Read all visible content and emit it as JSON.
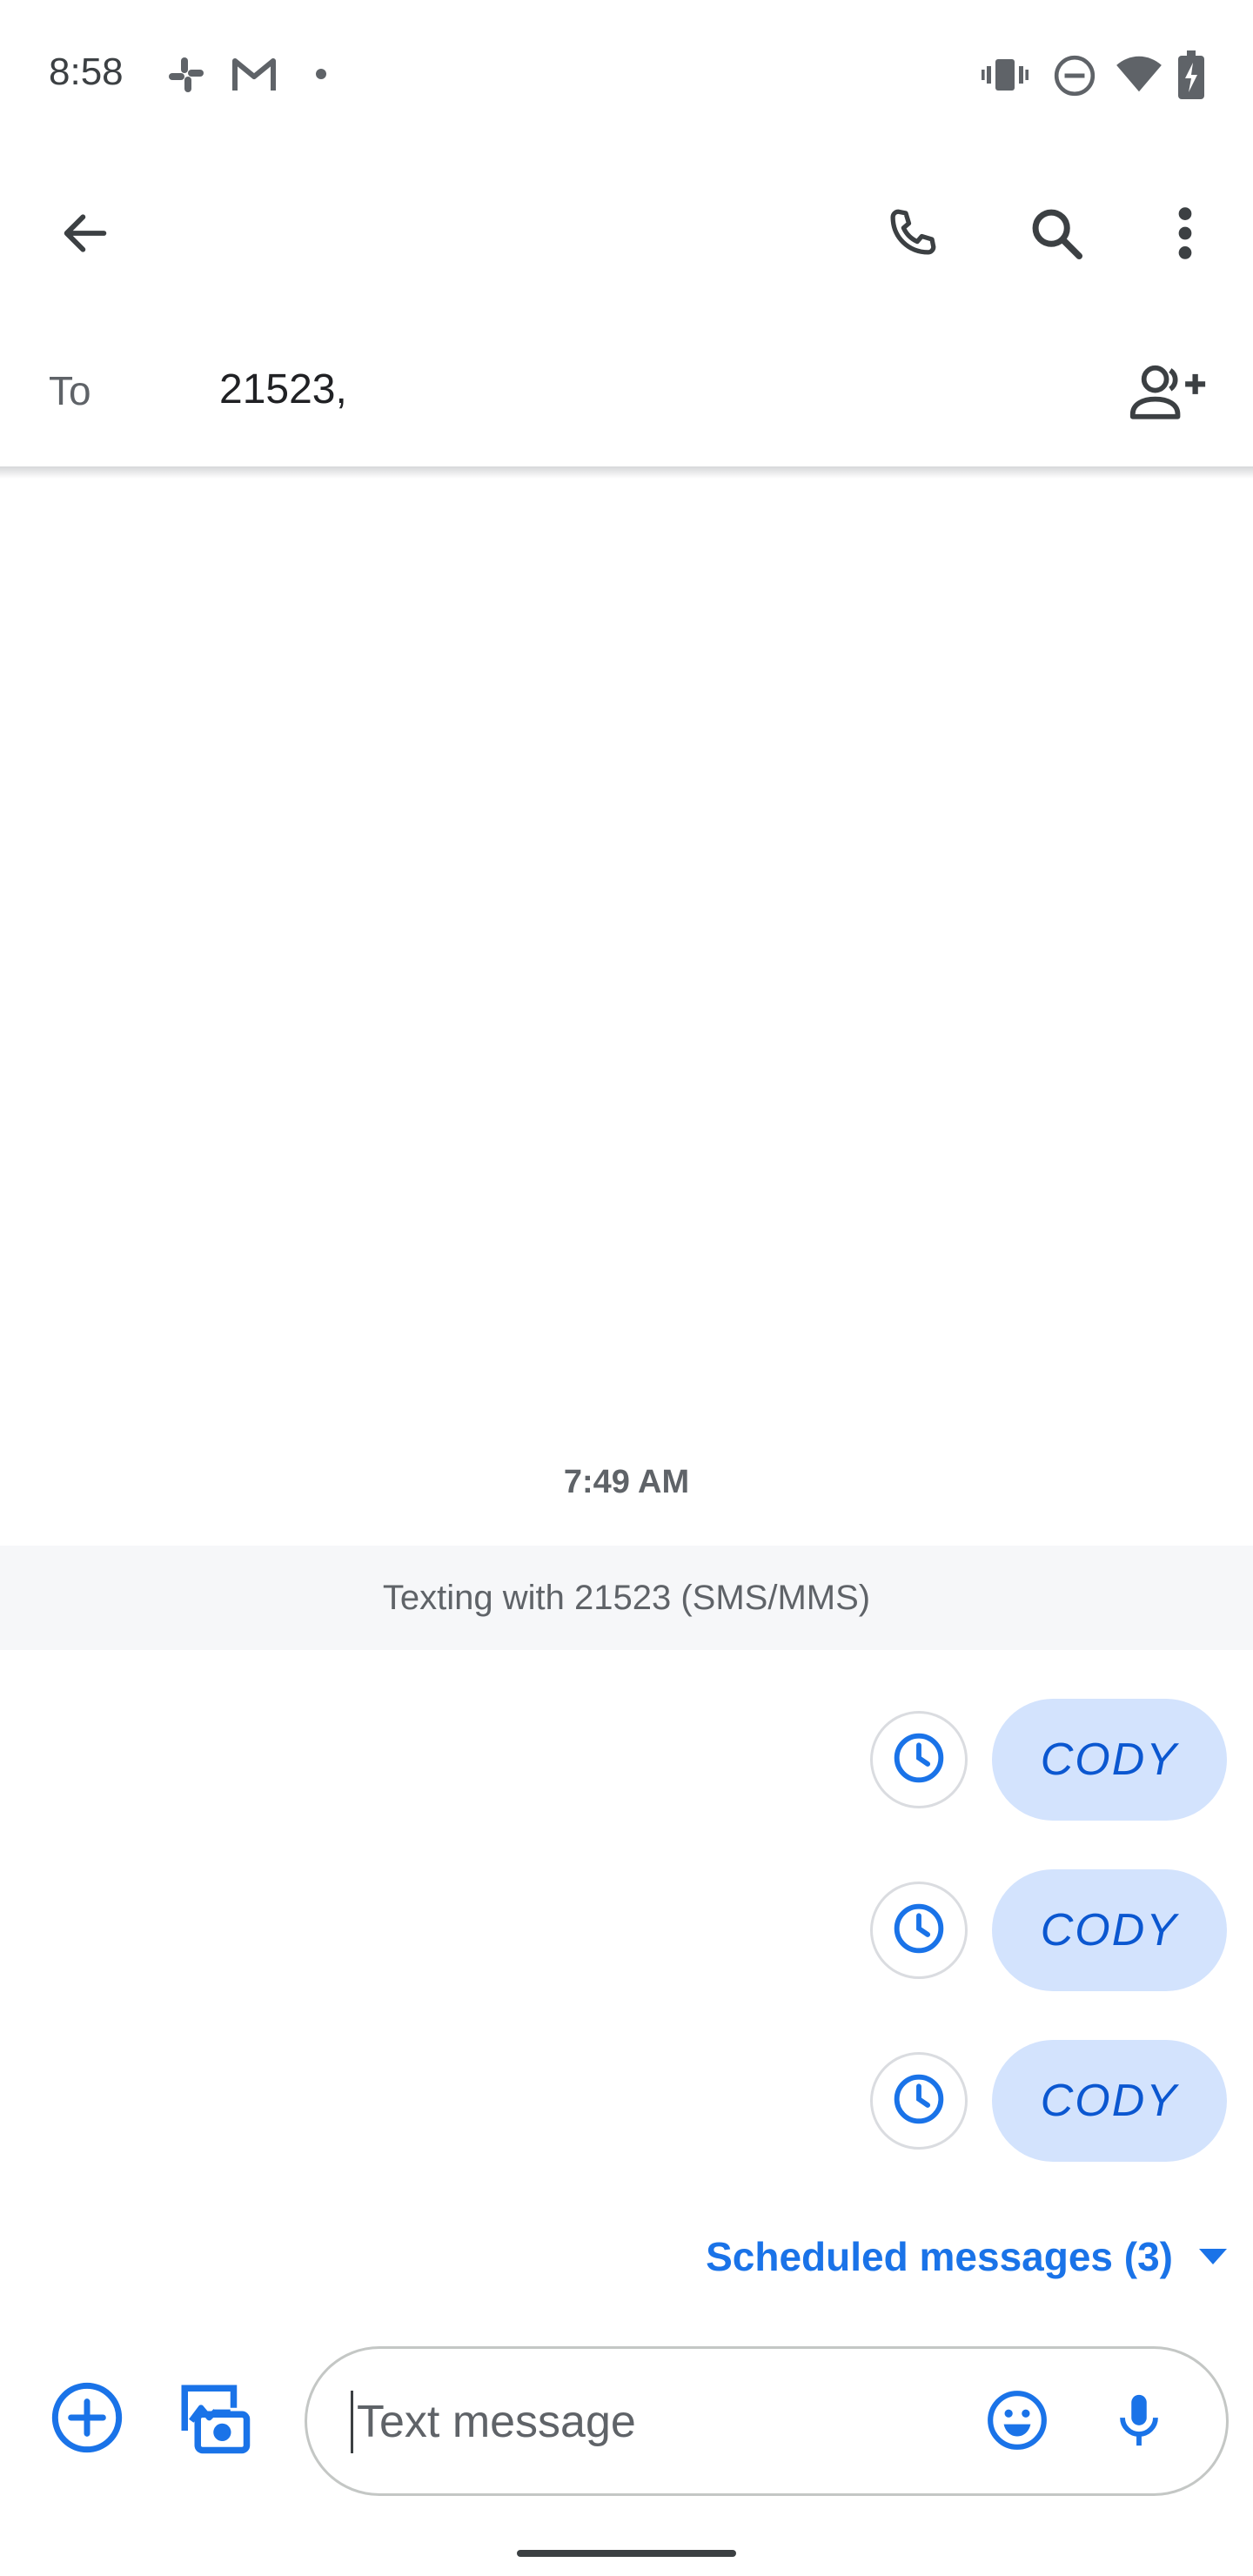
{
  "status_bar": {
    "time": "8:58"
  },
  "recipient": {
    "to_label": "To",
    "value": "21523,"
  },
  "conversation": {
    "timestamp": "7:49 AM",
    "banner": "Texting with 21523 (SMS/MMS)",
    "messages": [
      {
        "text": "CODY",
        "status": "scheduled"
      },
      {
        "text": "CODY",
        "status": "scheduled"
      },
      {
        "text": "CODY",
        "status": "scheduled"
      }
    ],
    "scheduled_toggle": "Scheduled messages (3)"
  },
  "compose": {
    "placeholder": "Text message"
  },
  "colors": {
    "accent": "#1a73e8",
    "bubble": "#d3e3fd",
    "banner_bg": "#f6f7f9"
  },
  "icons": {
    "back": "back-arrow-icon",
    "call": "phone-icon",
    "search": "search-icon",
    "more": "more-vert-icon",
    "add_contact": "add-person-icon",
    "scheduled": "clock-icon",
    "attach": "add-circle-icon",
    "gallery": "gallery-camera-icon",
    "emoji": "emoji-icon",
    "voice": "mic-icon"
  }
}
